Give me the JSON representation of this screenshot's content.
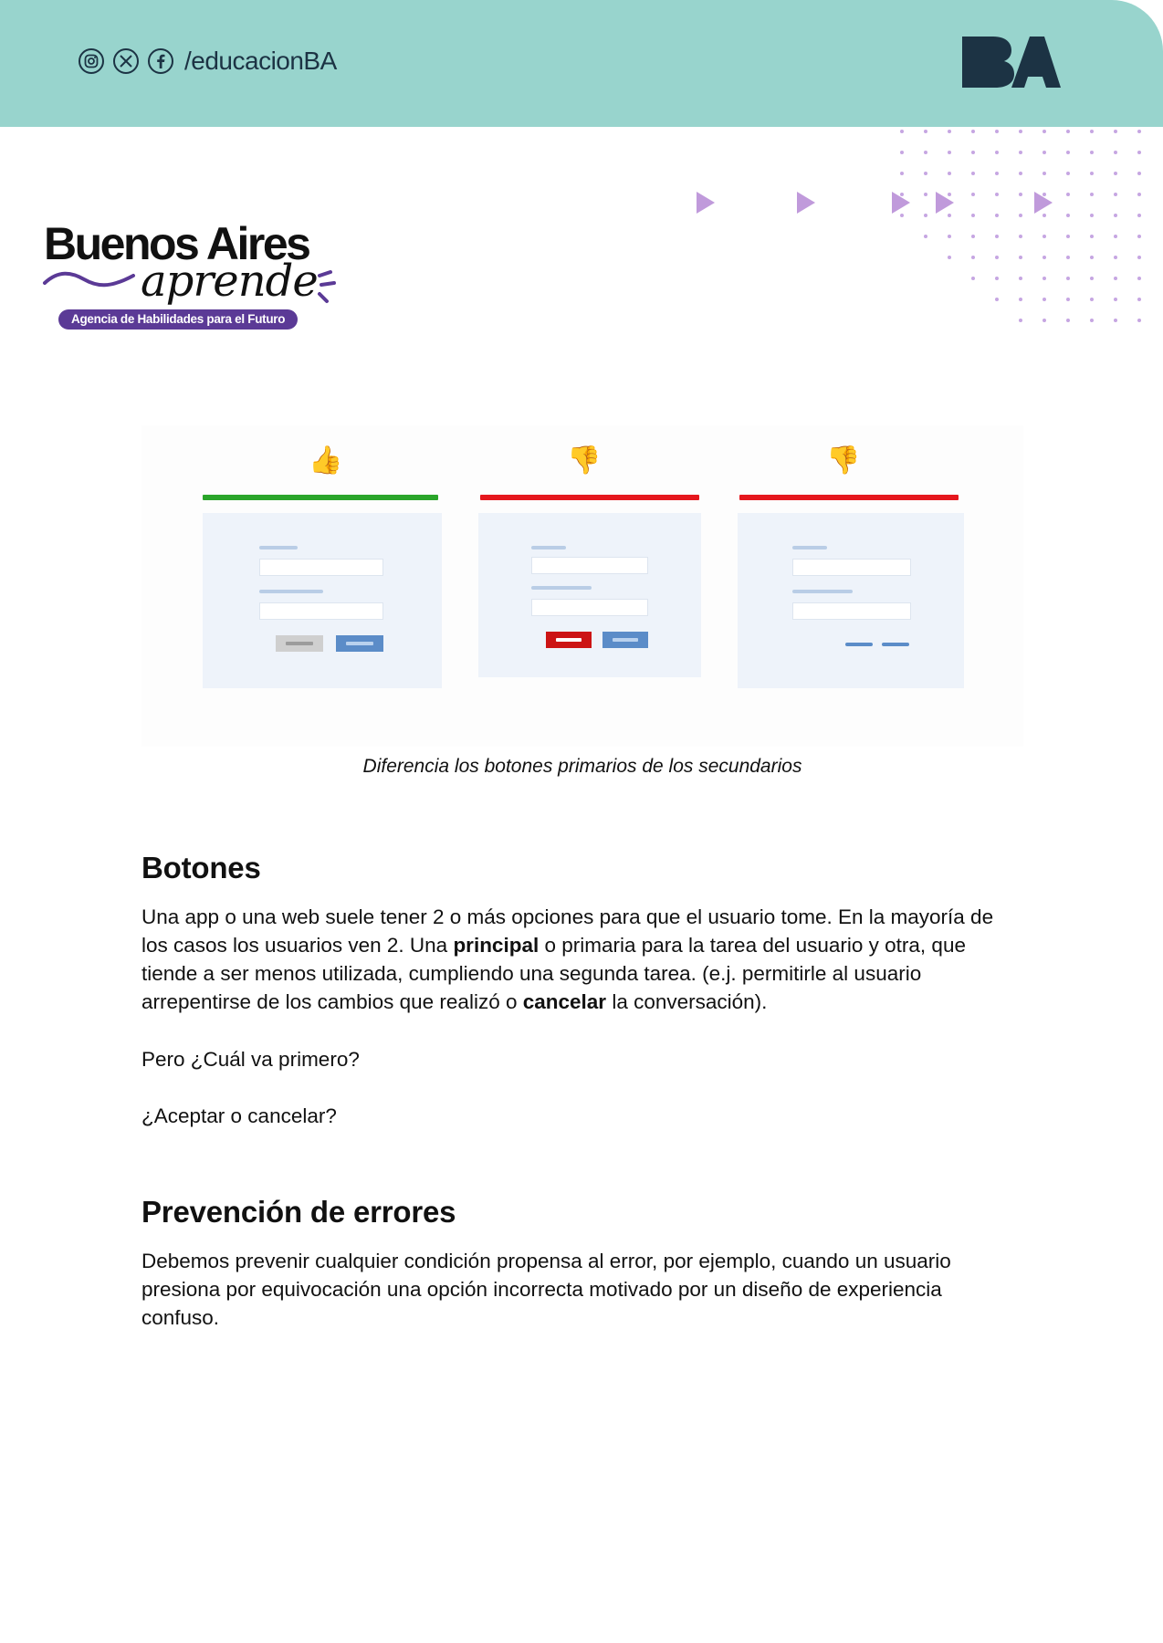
{
  "header": {
    "social_icons": [
      "instagram-icon",
      "x-icon",
      "facebook-icon"
    ],
    "handle": "/educacionBA",
    "logo_text": "BA",
    "background_color": "#98d4cd",
    "logo_color": "#1c3344"
  },
  "brand": {
    "title": "Buenos Aires",
    "script": "aprende",
    "tagline": "Agencia de Habilidades para el Futuro",
    "tagline_color": "#5b3a96"
  },
  "figure": {
    "panels": [
      {
        "verdict": "good",
        "thumb": "👍",
        "bar_color": "#2aa52a",
        "buttons": "gray-secondary-blue-primary"
      },
      {
        "verdict": "bad",
        "thumb": "👎",
        "bar_color": "#e5171d",
        "buttons": "red-and-blue"
      },
      {
        "verdict": "bad",
        "thumb": "👎",
        "bar_color": "#e5171d",
        "buttons": "two-blue-links"
      }
    ],
    "caption": "Diferencia los botones primarios de los secundarios"
  },
  "sections": [
    {
      "heading": "Botones",
      "p1": {
        "t1": "Una app o una web suele tener 2 o más opciones para que el usuario tome. En la mayoría de los casos los usuarios ven 2. Una ",
        "b1": "principal",
        "t2": " o primaria para la tarea del usuario y otra, que tiende a ser menos utilizada, cumpliendo una segunda tarea. (e.j. permitirle al usuario arrepentirse de los cambios que realizó o ",
        "b2": "cancelar",
        "t3": " la conversación)."
      },
      "p2": "Pero ¿Cuál va primero?",
      "p3": "¿Aceptar o cancelar?"
    },
    {
      "heading": "Prevención de errores",
      "p1": "Debemos prevenir cualquier condición propensa al error, por ejemplo, cuando un usuario presiona por equivocación una opción incorrecta motivado por un diseño de experiencia confuso."
    }
  ]
}
